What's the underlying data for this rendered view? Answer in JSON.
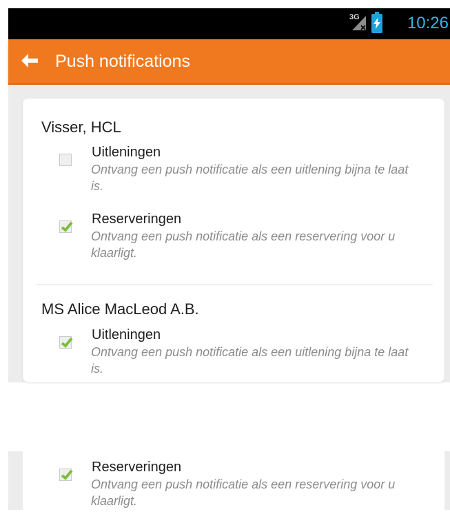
{
  "status_bar": {
    "network_type": "3G",
    "time": "10:26",
    "icons": [
      "signal-icon",
      "battery-charging-icon"
    ],
    "accent_color": "#33b5e5"
  },
  "header": {
    "back_icon": "arrow-left-icon",
    "title": "Push notifications",
    "background_color": "#f07920"
  },
  "accounts": [
    {
      "name": "Visser, HCL",
      "preferences": [
        {
          "label": "Uitleningen",
          "description": "Ontvang een push notificatie als een uitlening bijna te laat is.",
          "checked": false
        },
        {
          "label": "Reserveringen",
          "description": "Ontvang een push notificatie als een reservering voor u klaarligt.",
          "checked": true
        }
      ]
    },
    {
      "name": "MS Alice MacLeod A.B.",
      "preferences": [
        {
          "label": "Uitleningen",
          "description": "Ontvang een push notificatie als een uitlening bijna te laat is.",
          "checked": true
        },
        {
          "label": "Reserveringen",
          "description": "Ontvang een push notificatie als een reservering voor u klaarligt.",
          "checked": true
        }
      ]
    }
  ],
  "checkbox_check_color": "#7cbf3a"
}
